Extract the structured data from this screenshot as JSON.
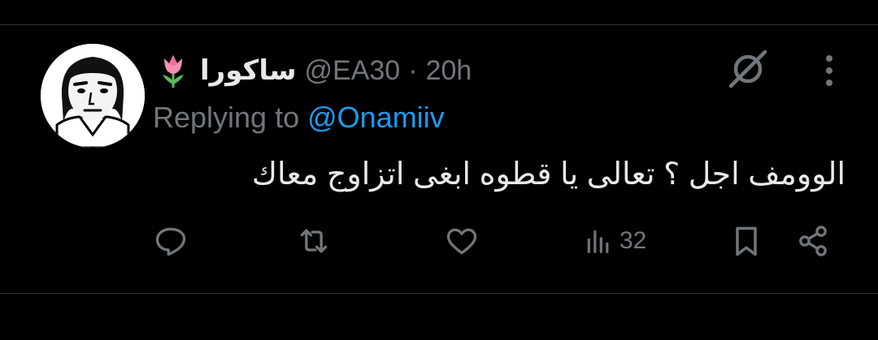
{
  "tweet": {
    "author_name": "ساكورا",
    "handle": "@EA30",
    "separator": "·",
    "time": "20h",
    "replying_prefix": "Replying to",
    "replying_to": "@Onamiiv",
    "text": "الوومف اجل ؟ تعالى يا قطوه ابغى اتزاوج معاك"
  },
  "actions": {
    "views_count": "32"
  },
  "icons": {
    "emoji": "tulip-emoji",
    "grok": "grok-icon",
    "more": "more-vertical-icon"
  },
  "colors": {
    "background": "#000000",
    "text": "#e7e9ea",
    "secondary": "#71767b",
    "accent": "#1d9bf0",
    "divider": "#2f3336"
  }
}
